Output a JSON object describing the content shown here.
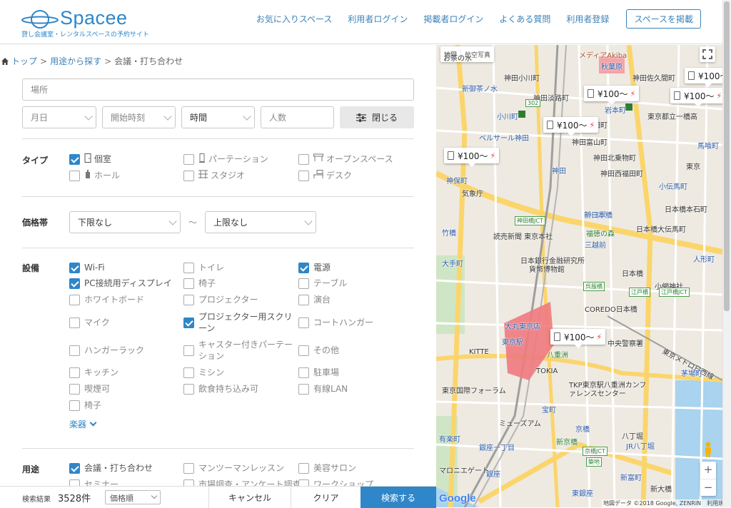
{
  "header": {
    "brand": "Spacee",
    "tagline": "貸し会議室・レンタルスペースの予約サイト",
    "nav": [
      "お気に入りスペース",
      "利用者ログイン",
      "掲載者ログイン",
      "よくある質問",
      "利用者登録"
    ],
    "post_button": "スペースを掲載",
    "brand_color": "#2f86c8"
  },
  "breadcrumb": {
    "home": "トップ",
    "parent": "用途から探す",
    "current": "会議・打ち合わせ"
  },
  "search": {
    "location_placeholder": "場所",
    "date_placeholder": "月日",
    "start_time_placeholder": "開始時刻",
    "time_selected": "時間",
    "people_placeholder": "人数",
    "close_label": "閉じる"
  },
  "type": {
    "label": "タイプ",
    "options": [
      {
        "label": "個室",
        "checked": true,
        "icon": "door-icon"
      },
      {
        "label": "パーテーション",
        "checked": false,
        "icon": "partition-icon"
      },
      {
        "label": "オープンスペース",
        "checked": false,
        "icon": "open-space-icon"
      },
      {
        "label": "ホール",
        "checked": false,
        "icon": "hall-icon"
      },
      {
        "label": "スタジオ",
        "checked": false,
        "icon": "studio-icon"
      },
      {
        "label": "デスク",
        "checked": false,
        "icon": "desk-icon"
      }
    ]
  },
  "price": {
    "label": "価格帯",
    "min": "下限なし",
    "tilde": "〜",
    "max": "上限なし"
  },
  "equipment": {
    "label": "設備",
    "options": [
      {
        "label": "Wi-Fi",
        "checked": true
      },
      {
        "label": "トイレ",
        "checked": false
      },
      {
        "label": "電源",
        "checked": true
      },
      {
        "label": "PC接続用ディスプレイ",
        "checked": true
      },
      {
        "label": "椅子",
        "checked": false
      },
      {
        "label": "テーブル",
        "checked": false
      },
      {
        "label": "ホワイトボード",
        "checked": false
      },
      {
        "label": "プロジェクター",
        "checked": false
      },
      {
        "label": "演台",
        "checked": false
      },
      {
        "label": "マイク",
        "checked": false
      },
      {
        "label": "プロジェクター用スクリーン",
        "checked": true
      },
      {
        "label": "コートハンガー",
        "checked": false
      },
      {
        "label": "ハンガーラック",
        "checked": false
      },
      {
        "label": "キャスター付きパーテーション",
        "checked": false
      },
      {
        "label": "その他",
        "checked": false
      },
      {
        "label": "キッチン",
        "checked": false
      },
      {
        "label": "ミシン",
        "checked": false
      },
      {
        "label": "駐車場",
        "checked": false
      },
      {
        "label": "喫煙可",
        "checked": false
      },
      {
        "label": "飲食持ち込み可",
        "checked": false
      },
      {
        "label": "有線LAN",
        "checked": false
      },
      {
        "label": "椅子",
        "checked": false
      }
    ],
    "more_label": "楽器"
  },
  "usage": {
    "label": "用途",
    "options": [
      {
        "label": "会議・打ち合わせ",
        "checked": true
      },
      {
        "label": "マンツーマンレッスン",
        "checked": false
      },
      {
        "label": "美容サロン",
        "checked": false
      },
      {
        "label": "セミナー",
        "checked": false
      },
      {
        "label": "市場調査・アンケート調査",
        "checked": false
      },
      {
        "label": "ワークショップ",
        "checked": false
      }
    ]
  },
  "footer": {
    "result_label": "検索結果",
    "result_count": "3528件",
    "sort_label": "価格順",
    "cancel": "キャンセル",
    "clear": "クリア",
    "search": "検索する"
  },
  "map": {
    "map_type": "地図",
    "satellite_type": "航空写真",
    "google": "Google",
    "attribution": "地図データ ©2018 Google, ZENRIN　利用規約",
    "price_markers": [
      {
        "price": "¥100〜"
      },
      {
        "price": "¥100〜"
      },
      {
        "price": "¥100〜"
      },
      {
        "price": "¥100〜"
      },
      {
        "price": "¥100〜"
      },
      {
        "price": "¥100〜"
      }
    ],
    "place_labels": [
      "お茶の水",
      "メディアAkiba",
      "秋葉原",
      "神田佐久間町",
      "神田小川町",
      "新御茶ノ水",
      "神田淡路町",
      "岩本町",
      "小川町",
      "東京都立一橋高",
      "ベルサール神田",
      "神田須田町",
      "神田富山町",
      "馬喰町",
      "神田北乗物町",
      "神田",
      "神田西福田町",
      "神保町",
      "東京",
      "小伝馬町",
      "気象庁",
      "神田駅",
      "新日本橋",
      "日本橋本石町",
      "読売新聞 東京本社",
      "福徳の森",
      "三越前",
      "日本橋大伝馬町",
      "竹橋",
      "大手町",
      "日本銀行金融研究所",
      "貨幣博物館",
      "人形町",
      "日本橋",
      "小網神社",
      "COREDO日本橋",
      "東京駅",
      "大丸東京店",
      "中央警察署",
      "八重洲",
      "KITTE",
      "TOKIA",
      "東京メトロ日西線",
      "茅場町",
      "宝町",
      "東京国際フォーラム",
      "TKP東京駅八重洲カンファレンスセンター",
      "京橋",
      "八丁堀",
      "新京橋",
      "JR八丁堀",
      "銀座一丁目",
      "有楽町",
      "銀座",
      "東銀座",
      "新富町",
      "新大橋",
      "マロニエゲート",
      "ミューズアム"
    ],
    "road_labels": [
      "302",
      "神田橋JCT",
      "江戸橋",
      "江戸橋JCT",
      "呉服橋",
      "京橋JCT",
      "築地"
    ]
  }
}
